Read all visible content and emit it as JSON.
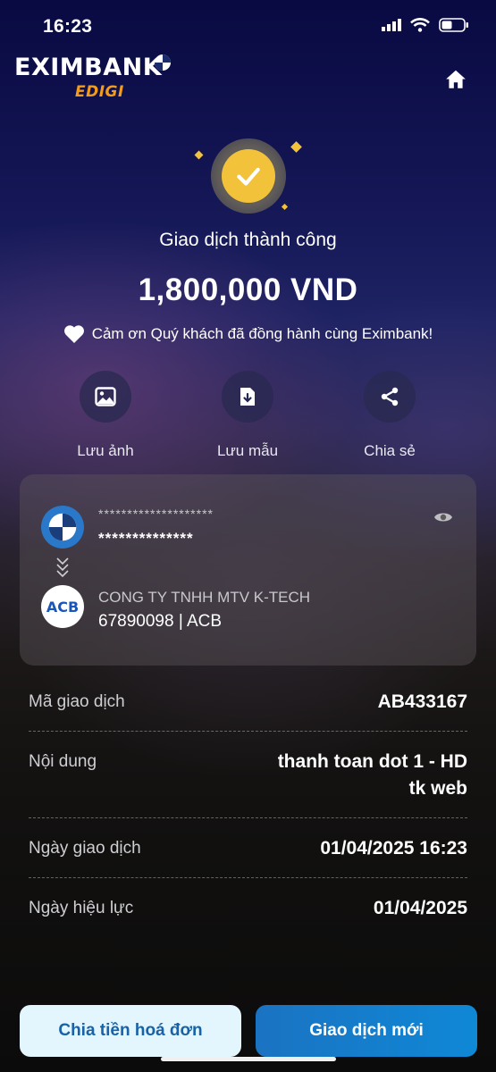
{
  "status_bar": {
    "time": "16:23"
  },
  "header": {
    "brand": "EXIMBANK",
    "brand_sub": "EDIGI",
    "home_icon": "home-icon"
  },
  "result": {
    "title": "Giao dịch thành công",
    "amount": "1,800,000 VND",
    "thanks": "Cảm ơn Quý khách đã đồng hành cùng Eximbank!"
  },
  "actions": [
    {
      "label": "Lưu ảnh",
      "icon": "image-icon"
    },
    {
      "label": "Lưu mẫu",
      "icon": "save-template-icon"
    },
    {
      "label": "Chia sẻ",
      "icon": "share-icon"
    }
  ],
  "transfer": {
    "source_mask_1": "********************",
    "source_mask_2": "**************",
    "receiver_bank_logo": "ACB",
    "receiver_name": "CONG TY TNHH MTV K-TECH",
    "receiver_account": "67890098 | ACB"
  },
  "details": [
    {
      "label": "Mã giao dịch",
      "value": "AB433167"
    },
    {
      "label": "Nội dung",
      "value": "thanh toan dot 1 - HD\ntk web"
    },
    {
      "label": "Ngày giao dịch",
      "value": "01/04/2025 16:23"
    },
    {
      "label": "Ngày hiệu lực",
      "value": "01/04/2025"
    }
  ],
  "buttons": {
    "split_bill": "Chia tiền hoá đơn",
    "new_transaction": "Giao dịch mới"
  },
  "colors": {
    "accent_gold": "#f2c23a",
    "brand_orange": "#f29b1d",
    "primary_blue": "#1a73c2"
  }
}
